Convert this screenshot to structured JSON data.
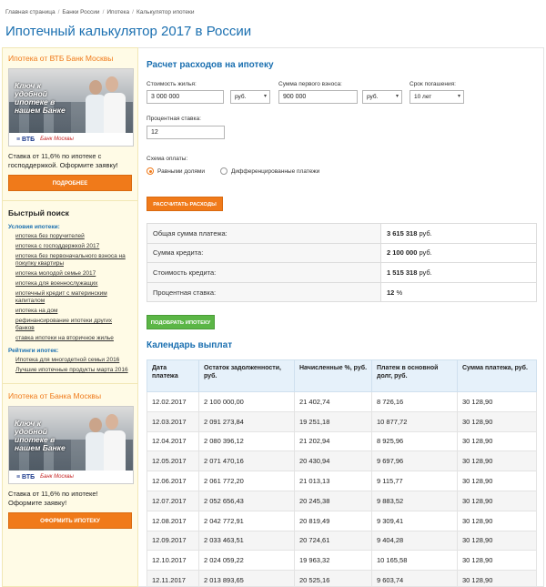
{
  "breadcrumb": [
    "Главная страница",
    "Банки России",
    "Ипотека",
    "Калькулятор ипотеки"
  ],
  "breadcrumb_sep": "/",
  "page_title": "Ипотечный калькулятор 2017 в России",
  "sidebar": {
    "promo1": {
      "title": "Ипотека от ВТБ Банк Москвы",
      "ad_text": "Ключ к удобной ипотеке в нашем Банке",
      "ad_logo_vtb": "ВТБ",
      "ad_logo_bm": "Банк Москвы",
      "text": "Ставка от 11,6% по ипотеке с господдержкой. Оформите заявку!",
      "button": "ПОДРОБНЕЕ"
    },
    "quick_search": {
      "title": "Быстрый поиск",
      "conditions_title": "Условия ипотеки:",
      "conditions": [
        "ипотека без поручителей",
        "ипотека с господдержкой 2017",
        "ипотека без первоначального взноса на покупку квартиры",
        "ипотека молодой семье 2017",
        "ипотека для военнослужащих",
        "ипотечный кредит с материнским капиталом",
        "ипотека на дом",
        "рефинансирование ипотеки других банков",
        "ставка ипотеки на вторичное жилье"
      ],
      "ratings_title": "Рейтинги ипотек:",
      "ratings": [
        "Ипотека для многодетной семьи 2016",
        "Лучшие ипотечные продукты марта 2016"
      ]
    },
    "promo2": {
      "title": "Ипотека от Банка Москвы",
      "ad_text": "Ключ к удобной ипотеке в нашем Банке",
      "ad_logo_vtb": "ВТБ",
      "ad_logo_bm": "Банк Москвы",
      "text": "Ставка от 11,6% по ипотеке! Оформите заявку!",
      "button": "ОФОРМИТЬ ИПОТЕКУ"
    }
  },
  "calculator": {
    "title": "Расчет расходов на ипотеку",
    "price_label": "Стоимость жилья:",
    "price_value": "3 000 000",
    "price_currency": "руб.",
    "down_label": "Сумма первого взноса:",
    "down_value": "900 000",
    "down_currency": "руб.",
    "term_label": "Срок погашения:",
    "term_value": "10 лет",
    "rate_label": "Процентная ставка:",
    "rate_value": "12",
    "scheme_label": "Схема оплаты:",
    "scheme_option1": "Равными долями",
    "scheme_option2": "Дифференцированные платежи",
    "scheme_selected": "Равными долями",
    "calc_button": "РАССЧИТАТЬ РАСХОДЫ",
    "pick_button": "ПОДОБРАТЬ ИПОТЕКУ"
  },
  "summary": [
    {
      "label": "Общая сумма платежа:",
      "value": "3 615 318",
      "unit": "руб."
    },
    {
      "label": "Сумма кредита:",
      "value": "2 100 000",
      "unit": "руб."
    },
    {
      "label": "Стоимость кредита:",
      "value": "1 515 318",
      "unit": "руб."
    },
    {
      "label": "Процентная ставка:",
      "value": "12",
      "unit": "%"
    }
  ],
  "schedule": {
    "title": "Календарь выплат",
    "headers": [
      "Дата платежа",
      "Остаток задолженности, руб.",
      "Начисленные %, руб.",
      "Платеж в основной долг, руб.",
      "Сумма платежа, руб."
    ],
    "rows": [
      [
        "12.02.2017",
        "2 100 000,00",
        "21 402,74",
        "8 726,16",
        "30 128,90"
      ],
      [
        "12.03.2017",
        "2 091 273,84",
        "19 251,18",
        "10 877,72",
        "30 128,90"
      ],
      [
        "12.04.2017",
        "2 080 396,12",
        "21 202,94",
        "8 925,96",
        "30 128,90"
      ],
      [
        "12.05.2017",
        "2 071 470,16",
        "20 430,94",
        "9 697,96",
        "30 128,90"
      ],
      [
        "12.06.2017",
        "2 061 772,20",
        "21 013,13",
        "9 115,77",
        "30 128,90"
      ],
      [
        "12.07.2017",
        "2 052 656,43",
        "20 245,38",
        "9 883,52",
        "30 128,90"
      ],
      [
        "12.08.2017",
        "2 042 772,91",
        "20 819,49",
        "9 309,41",
        "30 128,90"
      ],
      [
        "12.09.2017",
        "2 033 463,51",
        "20 724,61",
        "9 404,28",
        "30 128,90"
      ],
      [
        "12.10.2017",
        "2 024 059,22",
        "19 963,32",
        "10 165,58",
        "30 128,90"
      ],
      [
        "12.11.2017",
        "2 013 893,65",
        "20 525,16",
        "9 603,74",
        "30 128,90"
      ]
    ]
  },
  "colors": {
    "accent_blue": "#1a6fb0",
    "orange": "#f07a1a",
    "green": "#5bb646",
    "sidebar_bg": "#fffbe6"
  }
}
